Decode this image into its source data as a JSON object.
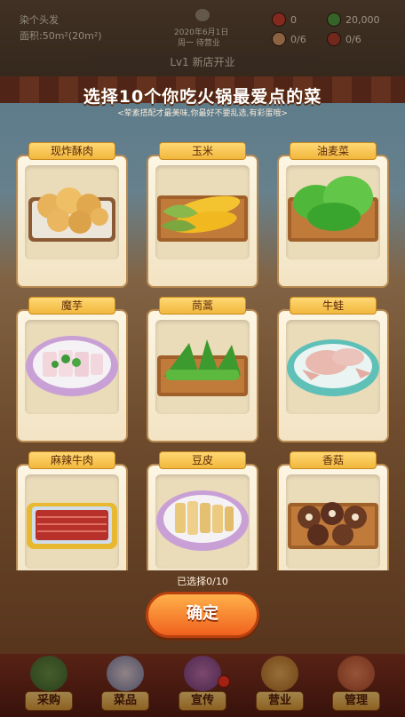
{
  "header": {
    "shop_name": "染个头发",
    "area_label": "面积:",
    "area_value": "50m²(20m²)",
    "date": "2020年6月1日",
    "status": "周一 待营业",
    "level_banner": "Lv1 新店开业",
    "stats": [
      {
        "icon": "tomato-icon",
        "value": "0"
      },
      {
        "icon": "cash-icon",
        "value": "20,000"
      },
      {
        "icon": "customer-icon",
        "value": "0/6"
      },
      {
        "icon": "hotpot-icon",
        "value": "0/6"
      }
    ]
  },
  "modal": {
    "title": "选择10个你吃火锅最爱点的菜",
    "subtitle": "<荤素搭配才最美味,你最好不要乱选,有彩蛋哦>",
    "dishes": [
      {
        "name": "现炸酥肉",
        "icon": "fried-pork-icon"
      },
      {
        "name": "玉米",
        "icon": "corn-icon"
      },
      {
        "name": "油麦菜",
        "icon": "lettuce-icon"
      },
      {
        "name": "魔芋",
        "icon": "konjac-icon"
      },
      {
        "name": "茼蒿",
        "icon": "crown-daisy-icon"
      },
      {
        "name": "牛蛙",
        "icon": "bullfrog-icon"
      },
      {
        "name": "麻辣牛肉",
        "icon": "spicy-beef-icon"
      },
      {
        "name": "豆皮",
        "icon": "tofu-skin-icon"
      },
      {
        "name": "香菇",
        "icon": "shiitake-icon"
      }
    ],
    "selected_count": "已选择0/10",
    "confirm_label": "确定"
  },
  "nav": {
    "items": [
      {
        "label": "采购",
        "icon": "purchase-icon"
      },
      {
        "label": "菜品",
        "icon": "dishes-icon"
      },
      {
        "label": "宣传",
        "icon": "promotion-icon"
      },
      {
        "label": "营业",
        "icon": "business-icon"
      },
      {
        "label": "管理",
        "icon": "manage-icon"
      }
    ]
  },
  "colors": {
    "accent": "#f0621e",
    "tag": "#f1b73c",
    "badge": "#e0301c"
  }
}
